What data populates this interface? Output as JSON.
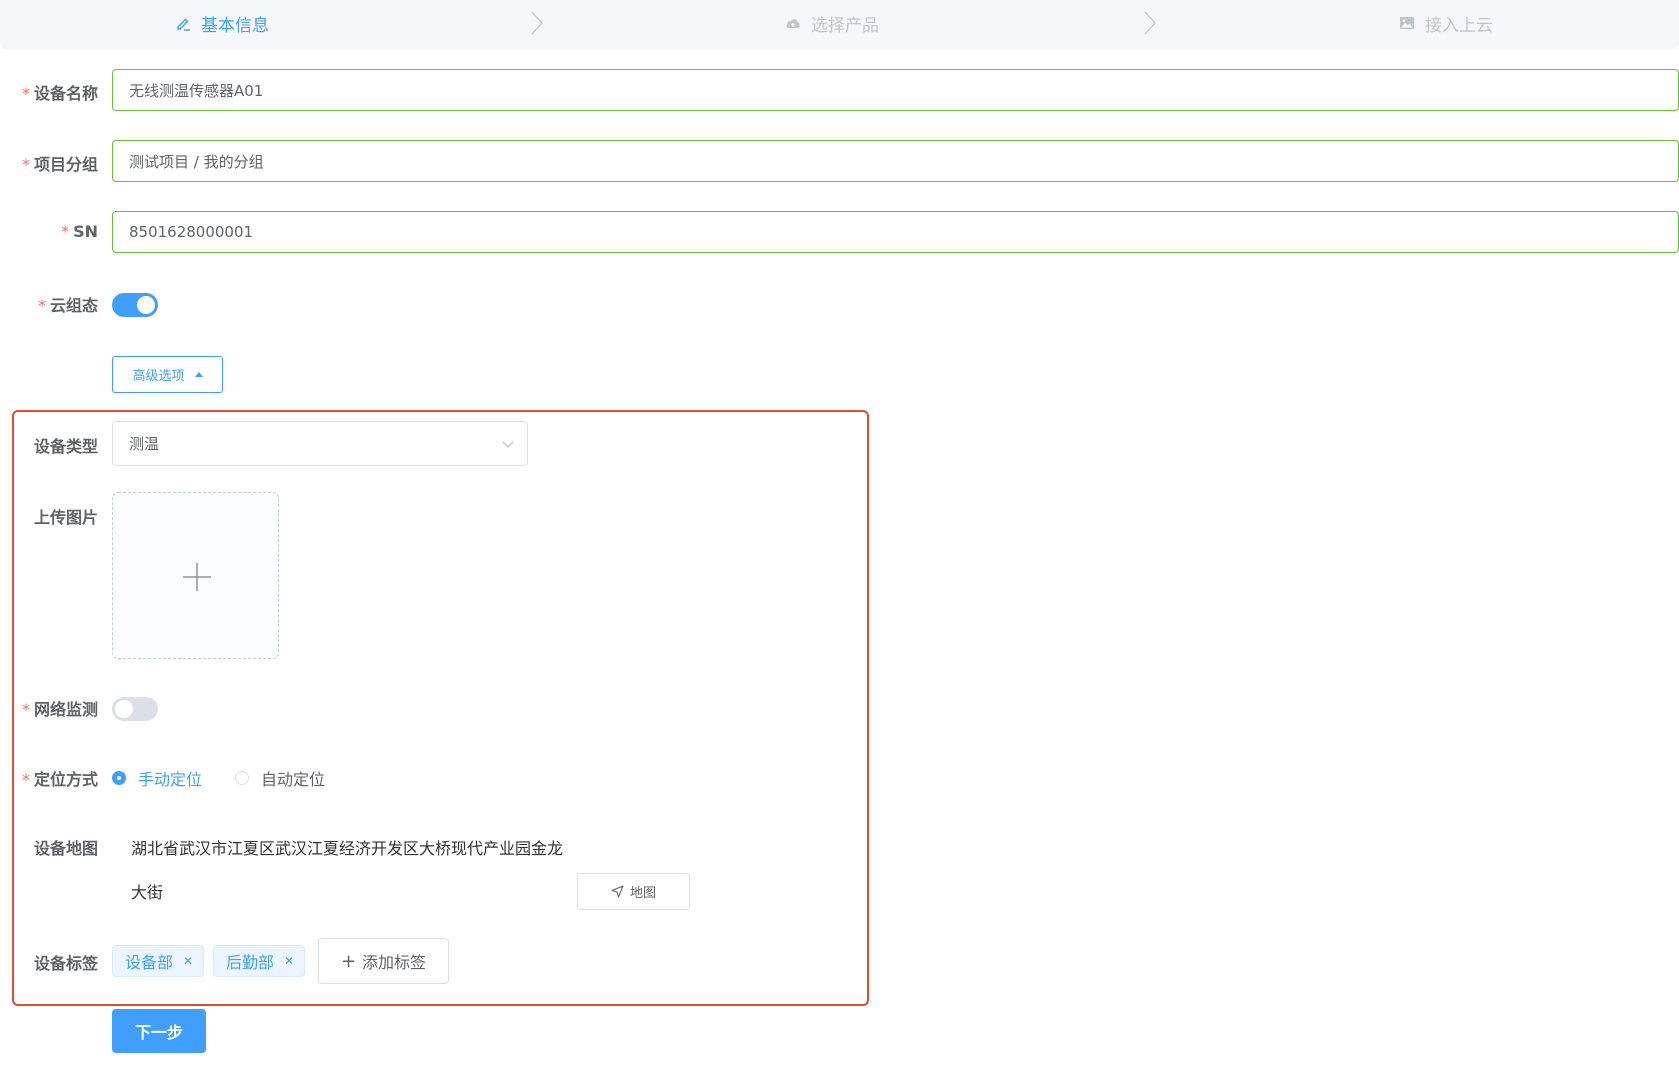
{
  "steps": [
    {
      "label": "基本信息",
      "icon": "edit-icon",
      "state": "active"
    },
    {
      "label": "选择产品",
      "icon": "cloud-upload-icon",
      "state": "inactive"
    },
    {
      "label": "接入上云",
      "icon": "picture-icon",
      "state": "inactive"
    }
  ],
  "form": {
    "device_name": {
      "label": "设备名称",
      "value": "无线测温传感器A01"
    },
    "project_group": {
      "label": "项目分组",
      "value": "测试项目 / 我的分组"
    },
    "sn": {
      "label": "SN",
      "value": "8501628000001"
    },
    "cloud_state": {
      "label": "云组态",
      "on": true
    },
    "advanced_button": "高级选项",
    "device_type": {
      "label": "设备类型",
      "value": "测温"
    },
    "upload_image": {
      "label": "上传图片"
    },
    "network_monitor": {
      "label": "网络监测",
      "on": false
    },
    "positioning": {
      "label": "定位方式",
      "options": [
        "手动定位",
        "自动定位"
      ],
      "selected": "手动定位"
    },
    "device_map": {
      "label": "设备地图",
      "address_line1": "湖北省武汉市江夏区武汉江夏经济开发区大桥现代产业园金龙",
      "address_line2": "大街",
      "map_button": "地图"
    },
    "device_tags": {
      "label": "设备标签",
      "tags": [
        "设备部",
        "后勤部"
      ],
      "add_button": "添加标签"
    },
    "next_button": "下一步"
  },
  "colors": {
    "primary": "#409eff",
    "valid_border": "#67c23a",
    "required_star": "#f56c6c",
    "highlight_box": "#e24a31"
  }
}
